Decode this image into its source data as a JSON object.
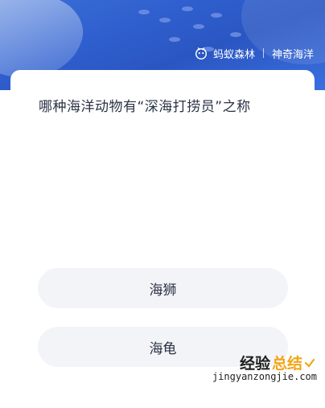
{
  "brand": {
    "app": "蚂蚁森林",
    "section": "神奇海洋"
  },
  "question": "哪种海洋动物有“深海打捞员”之称",
  "options": [
    {
      "label": "海狮"
    },
    {
      "label": "海龟"
    }
  ],
  "watermark": {
    "title_a": "经验",
    "title_b": "总结",
    "url": "jingyanzongjie.com"
  },
  "colors": {
    "banner": "#2f5fce",
    "option_bg": "#f3f4f7",
    "text": "#2b3346",
    "watermark_accent": "#f2a516"
  }
}
